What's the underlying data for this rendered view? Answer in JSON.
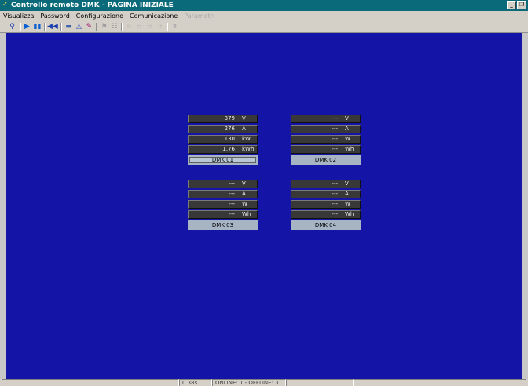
{
  "window": {
    "title": "Controllo remoto DMK -  PAGINA INIZIALE",
    "minimize_label": "_",
    "restore_label": "❐"
  },
  "menubar": {
    "items": [
      {
        "label": "Visualizza",
        "enabled": true
      },
      {
        "label": "Password",
        "enabled": true
      },
      {
        "label": "Configurazione",
        "enabled": true
      },
      {
        "label": "Comunicazione",
        "enabled": true
      },
      {
        "label": "Parametri",
        "enabled": false
      }
    ]
  },
  "toolbar": {
    "icons": [
      "search-icon",
      "play-icon",
      "pause-icon",
      "rewind-icon",
      "blank-icon",
      "bell-icon",
      "wrench-icon",
      "flag-icon",
      "list-icon",
      "register-icon",
      "register-icon",
      "register-icon",
      "register-icon",
      "network-icon"
    ]
  },
  "panels": [
    {
      "name": "DMK 01",
      "selected": true,
      "rows": [
        {
          "value": "379",
          "unit": "V"
        },
        {
          "value": "276",
          "unit": "A"
        },
        {
          "value": "130",
          "unit": "kW"
        },
        {
          "value": "1.76",
          "unit": "kWh"
        }
      ]
    },
    {
      "name": "DMK 02",
      "selected": false,
      "rows": [
        {
          "value": "---",
          "unit": "V"
        },
        {
          "value": "---",
          "unit": "A"
        },
        {
          "value": "---",
          "unit": "W"
        },
        {
          "value": "---",
          "unit": "Wh"
        }
      ]
    },
    {
      "name": "DMK 03",
      "selected": false,
      "rows": [
        {
          "value": "---",
          "unit": "V"
        },
        {
          "value": "---",
          "unit": "A"
        },
        {
          "value": "---",
          "unit": "W"
        },
        {
          "value": "---",
          "unit": "Wh"
        }
      ]
    },
    {
      "name": "DMK 04",
      "selected": false,
      "rows": [
        {
          "value": "---",
          "unit": "V"
        },
        {
          "value": "---",
          "unit": "A"
        },
        {
          "value": "---",
          "unit": "W"
        },
        {
          "value": "---",
          "unit": "Wh"
        }
      ]
    }
  ],
  "statusbar": {
    "cells": [
      "",
      "0.38s",
      "ONLINE: 1 - OFFLINE: 3",
      "",
      ""
    ]
  },
  "colors": {
    "titlebar": "#0a6a7a",
    "workspace": "#1414a6",
    "panel_row": "#383838",
    "panel_label": "#a6b4c4"
  }
}
